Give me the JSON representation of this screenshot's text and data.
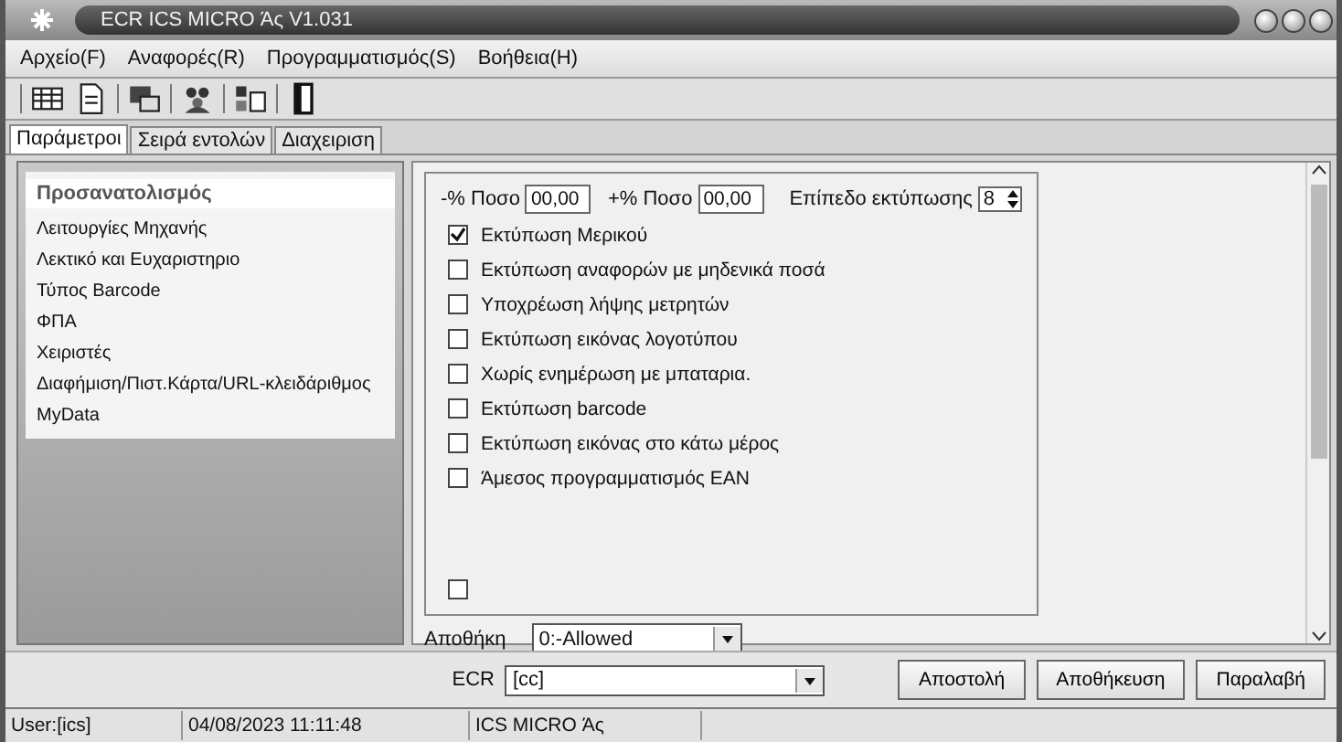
{
  "window": {
    "title": "ECR ICS MICRO Άς V1.031"
  },
  "menu": [
    "Αρχείο(F)",
    "Αναφορές(R)",
    "Προγραμματισμός(S)",
    "Βοήθεια(H)"
  ],
  "tabs": [
    {
      "label": "Παράμετροι",
      "selected": true
    },
    {
      "label": "Σειρά εντολών",
      "selected": false
    },
    {
      "label": "Διαχειριση",
      "selected": false
    }
  ],
  "sidebar": {
    "header": "Προσανατολισμός",
    "items": [
      "Λειτουργίες Μηχανής",
      "Λεκτικό και Ευχαριστηριο",
      "Τύπος Barcode",
      "ΦΠΑ",
      "Χειριστές",
      "Διαφήμιση/Πιστ.Κάρτα/URL-κλειδάριθμος",
      "MyData"
    ]
  },
  "settings": {
    "minus_label": "-% Ποσο",
    "minus_value": "00,00",
    "plus_label": "+% Ποσο",
    "plus_value": "00,00",
    "level_label": "Επίπεδο εκτύπωσης",
    "level_value": "8",
    "checkboxes": [
      {
        "label": "Εκτύπωση Μερικού",
        "checked": true
      },
      {
        "label": "Εκτύπωση αναφορών με μηδενικά ποσά",
        "checked": false
      },
      {
        "label": "Υποχρέωση λήψης μετρητών",
        "checked": false
      },
      {
        "label": "Εκτύπωση εικόνας  λογοτύπου",
        "checked": false
      },
      {
        "label": "Χωρίς ενημέρωση με μπαταρια.",
        "checked": false
      },
      {
        "label": "Εκτύπωση barcode",
        "checked": false
      },
      {
        "label": "Εκτύπωση εικόνας στο κάτω μέρος",
        "checked": false
      },
      {
        "label": "Άμεσος προγραμματισμός EAN",
        "checked": false
      }
    ],
    "extra_checkbox": {
      "checked": false
    },
    "storage_label": "Αποθήκη",
    "storage_value": "0:-Allowed"
  },
  "footer": {
    "ecr_label": "ECR",
    "ecr_value": "[cc]",
    "buttons": [
      "Αποστολή",
      "Αποθήκευση",
      "Παραλαβή"
    ]
  },
  "status_bar": [
    "User:[ics]",
    "04/08/2023 11:11:48",
    "ICS MICRO Άς"
  ]
}
